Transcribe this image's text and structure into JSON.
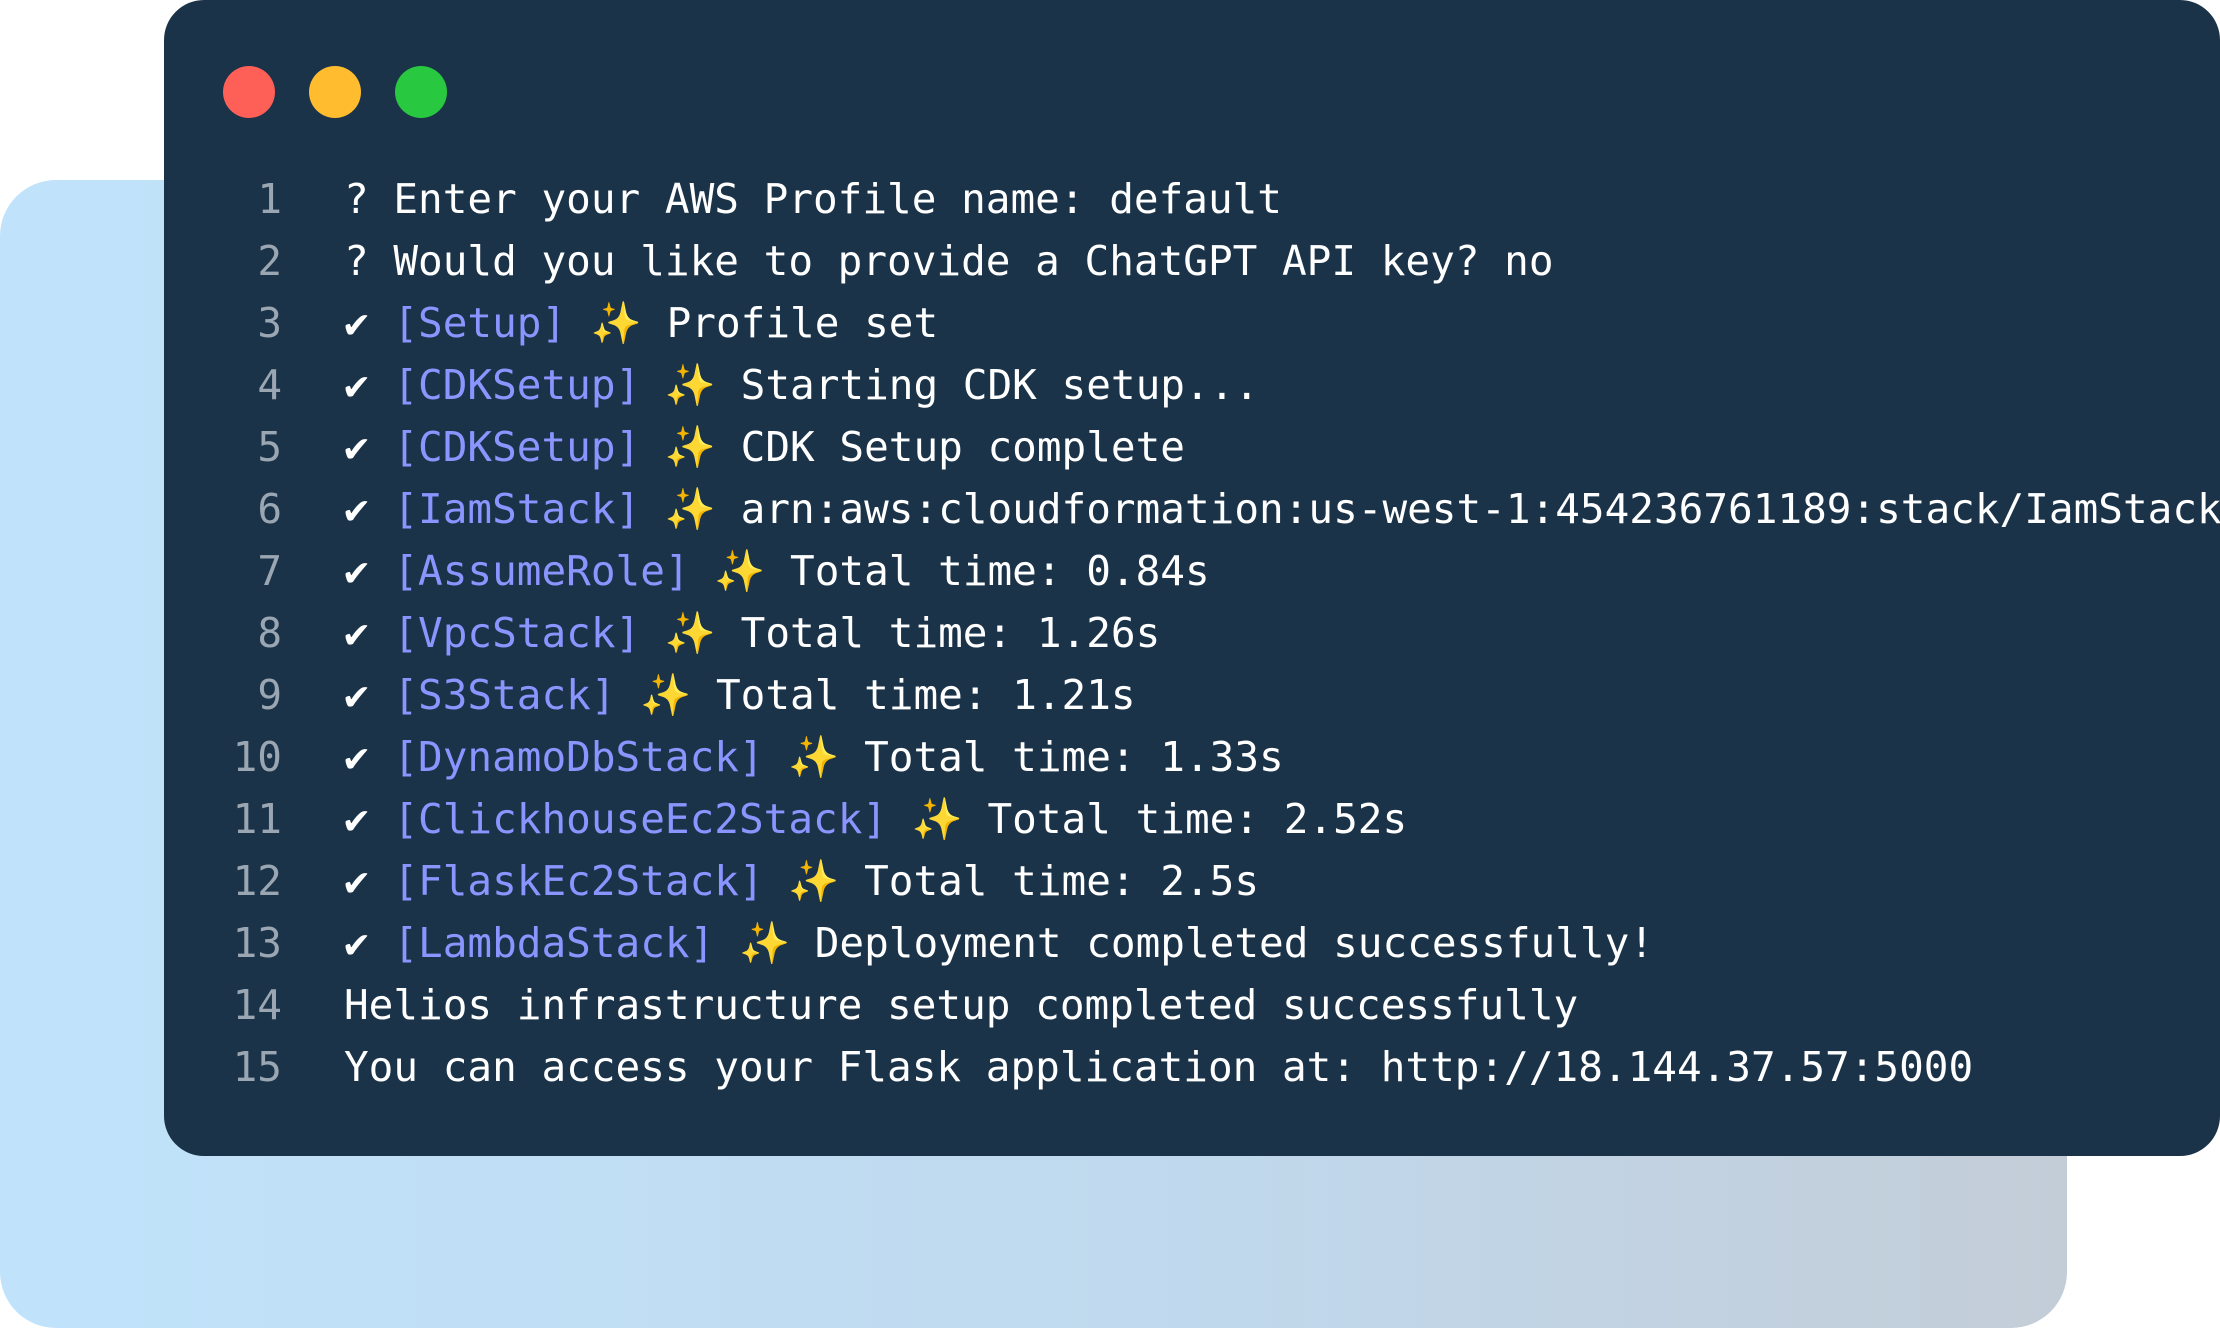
{
  "window": {
    "controls": [
      "close",
      "minimize",
      "zoom"
    ]
  },
  "terminal": {
    "lines": [
      {
        "num": "1",
        "pre": "? Enter your AWS Profile name: default"
      },
      {
        "num": "2",
        "pre": "? Would you like to provide a ChatGPT API key? no"
      },
      {
        "num": "3",
        "pre": "✔ ",
        "tag": "[Setup]",
        "mid": " ",
        "spark": "✨",
        "post": " Profile set"
      },
      {
        "num": "4",
        "pre": "✔ ",
        "tag": "[CDKSetup]",
        "mid": " ",
        "spark": "✨",
        "post": " Starting CDK setup..."
      },
      {
        "num": "5",
        "pre": "✔ ",
        "tag": "[CDKSetup]",
        "mid": " ",
        "spark": "✨",
        "post": " CDK Setup complete"
      },
      {
        "num": "6",
        "pre": "✔ ",
        "tag": "[IamStack]",
        "mid": " ",
        "spark": "✨",
        "post": " arn:aws:cloudformation:us-west-1:454236761189:stack/IamStack"
      },
      {
        "num": "7",
        "pre": "✔ ",
        "tag": "[AssumeRole]",
        "mid": " ",
        "spark": "✨",
        "post": " Total time: 0.84s"
      },
      {
        "num": "8",
        "pre": "✔ ",
        "tag": "[VpcStack]",
        "mid": " ",
        "spark": "✨",
        "post": " Total time: 1.26s"
      },
      {
        "num": "9",
        "pre": "✔ ",
        "tag": "[S3Stack]",
        "mid": " ",
        "spark": "✨",
        "post": " Total time: 1.21s"
      },
      {
        "num": "10",
        "pre": "✔ ",
        "tag": "[DynamoDbStack]",
        "mid": " ",
        "spark": "✨",
        "post": " Total time: 1.33s"
      },
      {
        "num": "11",
        "pre": "✔ ",
        "tag": "[ClickhouseEc2Stack]",
        "mid": " ",
        "spark": "✨",
        "post": " Total time: 2.52s"
      },
      {
        "num": "12",
        "pre": "✔ ",
        "tag": "[FlaskEc2Stack]",
        "mid": " ",
        "spark": "✨",
        "post": " Total time: 2.5s"
      },
      {
        "num": "13",
        "pre": "✔ ",
        "tag": "[LambdaStack]",
        "mid": " ",
        "spark": "✨",
        "post": " Deployment completed successfully!"
      },
      {
        "num": "14",
        "pre": "Helios infrastructure setup completed successfully"
      },
      {
        "num": "15",
        "pre": "You can access your Flask application at: http://18.144.37.57:5000"
      }
    ]
  },
  "colors": {
    "terminal_bg": "#1b3349",
    "tag": "#8b95ff",
    "sparkle": "#ffd33d",
    "line_number": "#9aa6b2"
  }
}
